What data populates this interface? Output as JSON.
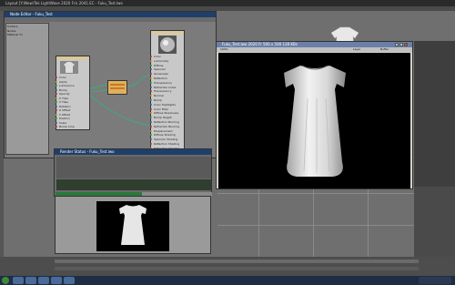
{
  "app": {
    "title": "Layout [Y:\\New\\Tek LightWave 2020 Fr.k 2041.EC - Fuku_Test.lwo",
    "menu_items": [
      "File",
      "Edit",
      "Window",
      "Help"
    ]
  },
  "node_editor": {
    "title": "Node Editor - Fuku_Test",
    "list_items": [
      "Surface",
      "Nodes",
      "Material T1"
    ],
    "image_node_ports": [
      "Color",
      "Alpha",
      "Luminance",
      "Bump",
      "Opacity",
      "U Tiles",
      "V Tiles",
      "Rotation",
      "U Offset",
      "V Offset",
      "Position",
      "Scale",
      "Bump Amp"
    ],
    "image_node_out": [
      "Color",
      "Alpha"
    ],
    "surface_node_ports": [
      "Color",
      "Luminosity",
      "Diffuse",
      "Specular",
      "Glossiness",
      "Reflection",
      "Transparency",
      "Refraction Index",
      "Translucency",
      "Normal",
      "Bump",
      "Color Highlights",
      "Color Filter",
      "Diffuse Sharpness",
      "Bump Height",
      "Reflection Blurring",
      "Refraction Blurring",
      "Displacement",
      "Diffuse Shading",
      "Specular Shading",
      "Reflection Shading",
      "Refraction Shading",
      "Material"
    ]
  },
  "render_window": {
    "title": "Fuku_Test.lwo 2020 Fr 500 x 500 128 KBs",
    "zoom": "100%",
    "mode": "Layer",
    "extra": "Buffer"
  },
  "info_dialog": {
    "title": "Render Status - Fuku_Test.lwo",
    "progress": 0.55
  },
  "preview": {
    "label": "Preview"
  },
  "taskbar": {
    "items": [
      "Start",
      "Explorer",
      "Layout",
      "Modeler",
      "Node"
    ]
  },
  "colors": {
    "titlebar": "#1f3f6a",
    "progress": "#2a7a3a",
    "taskbar": "#1f2d44"
  }
}
